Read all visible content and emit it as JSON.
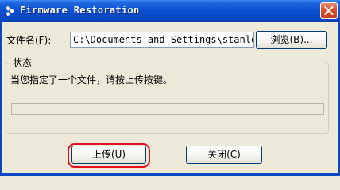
{
  "window": {
    "title": "Firmware Restoration"
  },
  "file_row": {
    "label": "文件名(F):",
    "path_value": "C:\\Documents and Settings\\stanle",
    "browse_label": "浏览(B)..."
  },
  "status_group": {
    "legend": "状态",
    "message": "当您指定了一个文件，请按上传按键。",
    "progress": 0
  },
  "actions": {
    "upload_label": "上传(U)",
    "close_label": "关闭(C)"
  },
  "colors": {
    "titlebar": "#0A4FD0",
    "window_bg": "#ECE9D8",
    "highlight": "#E0101E"
  }
}
